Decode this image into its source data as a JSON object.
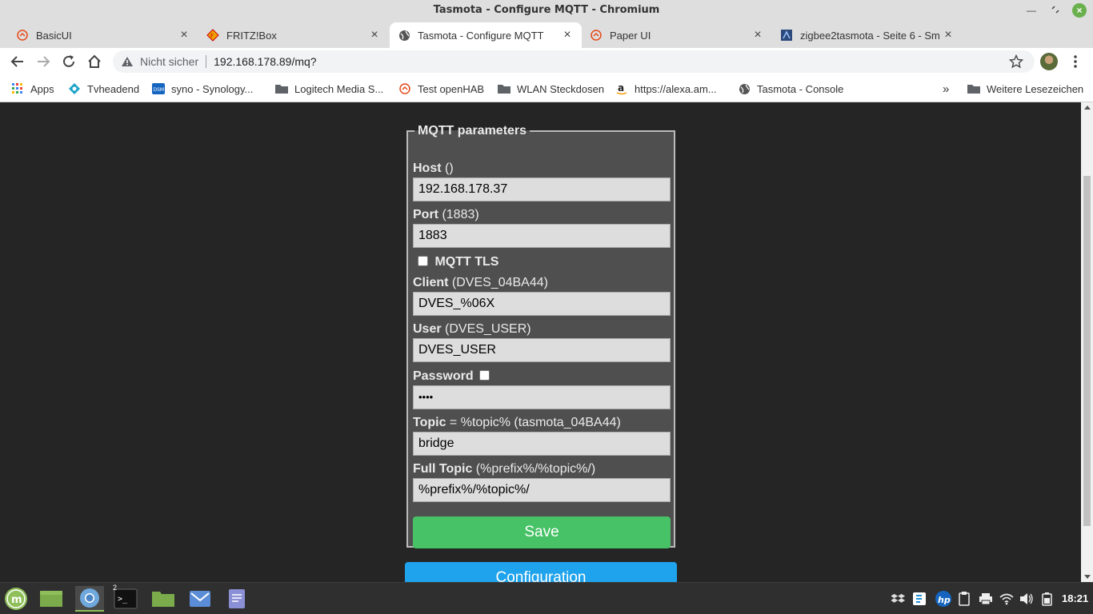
{
  "window": {
    "title": "Tasmota - Configure MQTT - Chromium"
  },
  "tabs": [
    {
      "label": "BasicUI",
      "icon": "openhab-icon"
    },
    {
      "label": "FRITZ!Box",
      "icon": "fritzbox-icon"
    },
    {
      "label": "Tasmota - Configure MQTT",
      "icon": "globe-icon",
      "active": true
    },
    {
      "label": "Paper UI",
      "icon": "openhab-icon"
    },
    {
      "label": "zigbee2tasmota - Seite 6 - Sm",
      "icon": "forum-icon"
    }
  ],
  "toolbar": {
    "security_label": "Nicht sicher",
    "url": "192.168.178.89/mq?"
  },
  "bookmarks": [
    {
      "label": "Apps",
      "icon": "apps-grid-icon"
    },
    {
      "label": "Tvheadend",
      "icon": "tvheadend-icon"
    },
    {
      "label": "syno - Synology...",
      "icon": "dsm-icon"
    },
    {
      "label": "Logitech Media S...",
      "icon": "folder-icon"
    },
    {
      "label": "Test openHAB",
      "icon": "openhab-icon"
    },
    {
      "label": "WLAN Steckdosen",
      "icon": "folder-icon"
    },
    {
      "label": "https://alexa.am...",
      "icon": "amazon-icon"
    },
    {
      "label": "Tasmota - Console",
      "icon": "globe-icon"
    }
  ],
  "bookmarks_more": "»",
  "bookmarks_other": "Weitere Lesezeichen",
  "form": {
    "legend": "MQTT parameters",
    "host": {
      "label": "Host",
      "hint": " ()",
      "value": "192.168.178.37"
    },
    "port": {
      "label": "Port",
      "hint": " (1883)",
      "value": "1883"
    },
    "tls": {
      "label": "MQTT TLS"
    },
    "client": {
      "label": "Client",
      "hint": " (DVES_04BA44)",
      "value": "DVES_%06X"
    },
    "user": {
      "label": "User",
      "hint": " (DVES_USER)",
      "value": "DVES_USER"
    },
    "password": {
      "label": "Password",
      "value": "••••"
    },
    "topic": {
      "label": "Topic",
      "hint": " = %topic% (tasmota_04BA44)",
      "value": "bridge"
    },
    "fulltopic": {
      "label": "Full Topic",
      "hint": " (%prefix%/%topic%/)",
      "value": "%prefix%/%topic%/"
    },
    "save_label": "Save",
    "config_label": "Configuration"
  },
  "taskbar": {
    "terminal_badge": "2",
    "clock": "18:21"
  }
}
